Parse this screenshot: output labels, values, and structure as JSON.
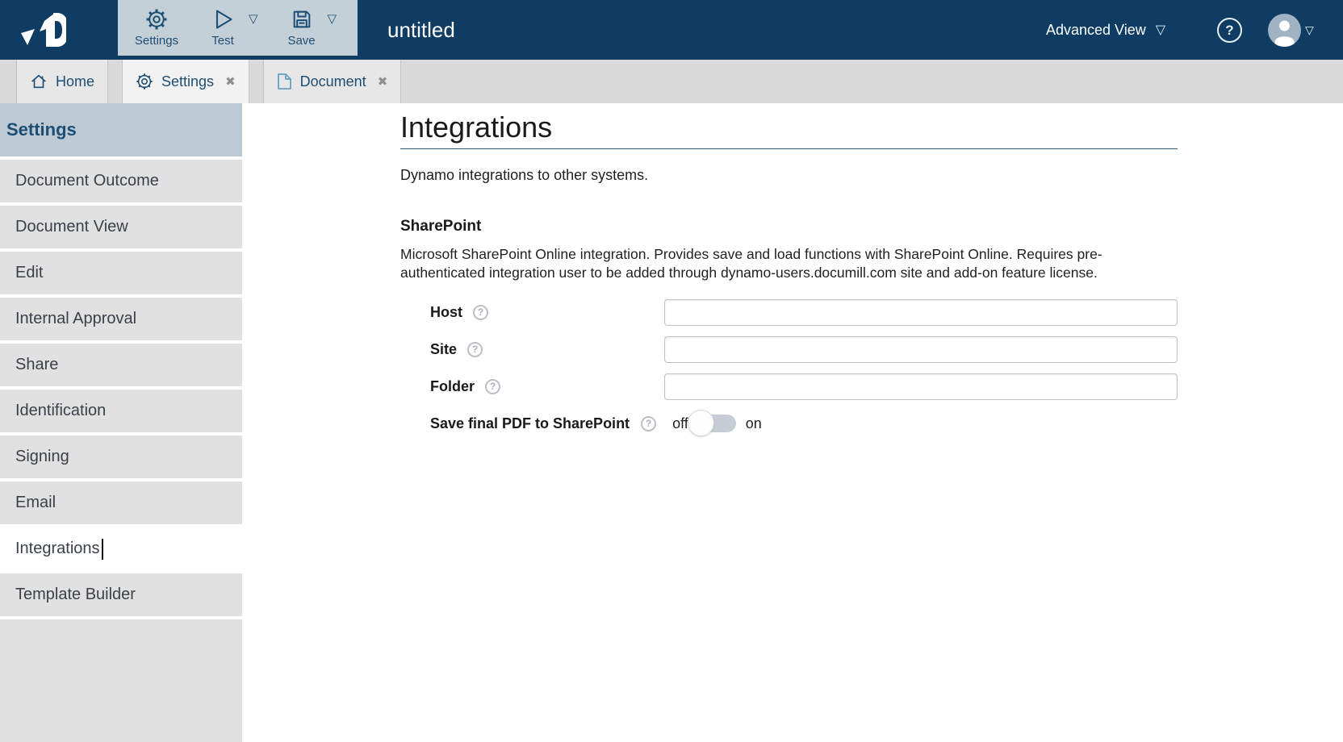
{
  "colors": {
    "header_navy": "#0e3c62",
    "toolbar_bg": "#c4d0d7",
    "accent_navy_text": "#1d4e75",
    "tabbar_bg": "#d9d9d9",
    "tab_bg": "#e7e7e7",
    "tab_active_bg": "#f2f2f2",
    "sidebar_header_bg": "#bdcad3",
    "sidebar_item_bg": "#e1e1e1",
    "sidebar_active_bg": "#ffffff",
    "avatar_bg": "#9fb3c2",
    "document_icon_blue": "#67a0c9",
    "toggle_track": "#c7cdd6",
    "heading_rule": "#2d5a80"
  },
  "icons": {
    "close_glyph": "✖",
    "dropdown_glyph": "▽",
    "help_glyph": "?"
  },
  "header": {
    "title": "untitled",
    "toolbar": [
      {
        "label": "Settings",
        "icon": "gear-icon",
        "has_dropdown": false
      },
      {
        "label": "Test",
        "icon": "play-icon",
        "has_dropdown": true
      },
      {
        "label": "Save",
        "icon": "save-icon",
        "has_dropdown": true
      }
    ],
    "view_selector": {
      "label": "Advanced View"
    }
  },
  "tabs": [
    {
      "label": "Home",
      "icon": "home-icon",
      "closable": false,
      "active": false
    },
    {
      "label": "Settings",
      "icon": "gear-icon",
      "closable": true,
      "active": true
    },
    {
      "label": "Document",
      "icon": "document-icon",
      "closable": true,
      "active": false
    }
  ],
  "sidebar": {
    "title": "Settings",
    "items": [
      {
        "label": "Document Outcome",
        "active": false
      },
      {
        "label": "Document View",
        "active": false
      },
      {
        "label": "Edit",
        "active": false
      },
      {
        "label": "Internal Approval",
        "active": false
      },
      {
        "label": "Share",
        "active": false
      },
      {
        "label": "Identification",
        "active": false
      },
      {
        "label": "Signing",
        "active": false
      },
      {
        "label": "Email",
        "active": false
      },
      {
        "label": "Integrations",
        "active": true
      },
      {
        "label": "Template Builder",
        "active": false
      }
    ]
  },
  "main": {
    "heading": "Integrations",
    "description": "Dynamo integrations to other systems.",
    "sharepoint": {
      "title": "SharePoint",
      "description": "Microsoft SharePoint Online integration. Provides save and load functions with SharePoint Online. Requires pre-authenticated integration user to be added through dynamo-users.documill.com site and add-on feature license.",
      "fields": [
        {
          "label": "Host",
          "value": ""
        },
        {
          "label": "Site",
          "value": ""
        },
        {
          "label": "Folder",
          "value": ""
        }
      ],
      "toggle": {
        "label": "Save final PDF to SharePoint",
        "off_label": "off",
        "on_label": "on",
        "state": "off"
      }
    }
  }
}
